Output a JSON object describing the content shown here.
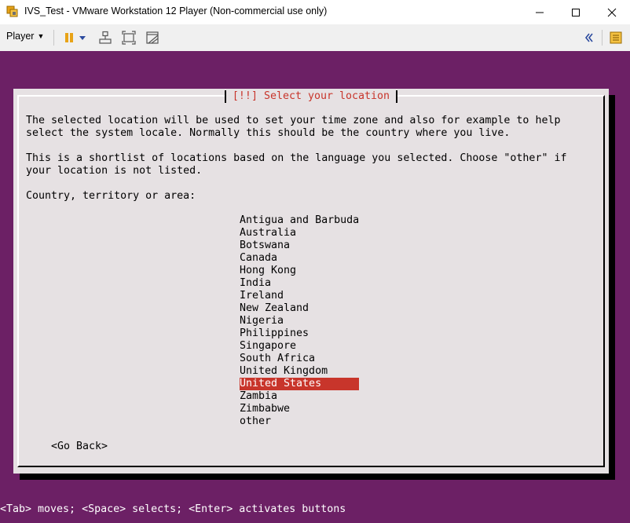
{
  "window": {
    "title": "IVS_Test - VMware Workstation 12 Player (Non-commercial use only)",
    "controls": {
      "minimize": "─",
      "maximize": "☐",
      "close": "✕"
    }
  },
  "toolbar": {
    "player_menu": "Player",
    "icons": [
      "pause-icon",
      "pause-dropdown-icon",
      "send-ctrl-alt-del-icon",
      "fit-guest-icon",
      "unity-icon",
      "collapse-icon",
      "library-icon"
    ]
  },
  "installer": {
    "title": "[!!] Select your location",
    "para1_line1": "The selected location will be used to set your time zone and also for example to help",
    "para1_line2": "select the system locale. Normally this should be the country where you live.",
    "para2_line1": "This is a shortlist of locations based on the language you selected. Choose \"other\" if",
    "para2_line2": "your location is not listed.",
    "prompt": "Country, territory or area:",
    "locations": [
      "Antigua and Barbuda",
      "Australia",
      "Botswana",
      "Canada",
      "Hong Kong",
      "India",
      "Ireland",
      "New Zealand",
      "Nigeria",
      "Philippines",
      "Singapore",
      "South Africa",
      "United Kingdom",
      "United States",
      "Zambia",
      "Zimbabwe",
      "other"
    ],
    "selected_location": "United States",
    "go_back": "<Go Back>",
    "status_line": "<Tab> moves; <Space> selects; <Enter> activates buttons"
  },
  "colors": {
    "vm_background": "#6c2065",
    "dialog_background": "#e6e1e3",
    "highlight": "#c8352b"
  }
}
